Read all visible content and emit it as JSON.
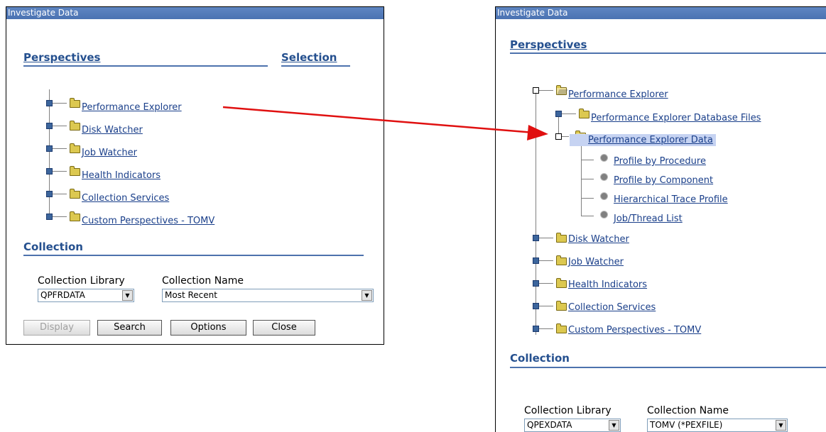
{
  "left": {
    "title": "Investigate Data",
    "perspectives_header": "Perspectives",
    "selection_header": "Selection",
    "tree": [
      "Performance Explorer",
      "Disk Watcher",
      "Job Watcher",
      "Health Indicators",
      "Collection Services",
      "Custom Perspectives - TOMV"
    ],
    "collection_header": "Collection",
    "collection_library_label": "Collection Library",
    "collection_name_label": "Collection Name",
    "collection_library_value": "QPFRDATA",
    "collection_name_value": "Most Recent",
    "buttons": {
      "display": "Display",
      "search": "Search",
      "options": "Options",
      "close": "Close"
    }
  },
  "right": {
    "title": "Investigate Data",
    "perspectives_header": "Perspectives",
    "tree_root": "Performance Explorer",
    "pex_children": [
      "Performance Explorer Database Files",
      "Performance Explorer Data"
    ],
    "pex_data_children": [
      "Profile by Procedure",
      "Profile by Component",
      "Hierarchical Trace Profile",
      "Job/Thread List"
    ],
    "tree_rest": [
      "Disk Watcher",
      "Job Watcher",
      "Health Indicators",
      "Collection Services",
      "Custom Perspectives - TOMV"
    ],
    "collection_header": "Collection",
    "collection_library_label": "Collection Library",
    "collection_name_label": "Collection Name",
    "collection_library_value": "QPEXDATA",
    "collection_name_value": "TOMV (*PEXFILE)"
  },
  "colors": {
    "title_bar": "#4a72b2",
    "header_text": "#25508f",
    "link": "#1a3f8a",
    "arrow": "#e01010",
    "selected_bg": "#c6d3f2"
  },
  "icons": {
    "expand": "expand-box-icon",
    "folder": "folder-icon",
    "leaf": "gear-icon",
    "select_arrow": "chevron-down-icon"
  }
}
